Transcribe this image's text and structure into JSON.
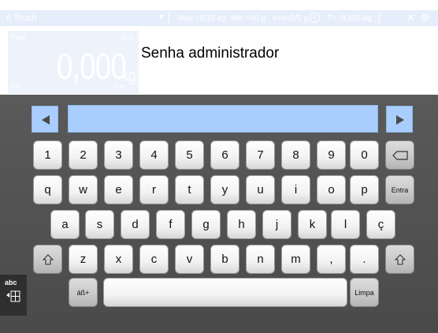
{
  "topbar": {
    "app_name": "6 Touch",
    "dropdown_glyph": "▼",
    "max": "Max =6/15 kg",
    "min": "Min =40 g",
    "e_d": "e=d=2/5 g",
    "zero_badge": "0",
    "tare": "T= -9,995 kg",
    "close_glyph": "✕",
    "settings_glyph": "⚙"
  },
  "weight_panel": {
    "peso_label": "Peso",
    "zero_label": "Zero",
    "value": "0,000",
    "unit": "kg",
    "scale_label": "3 kg",
    "tare_label": "T kg"
  },
  "prompt": "Senha administrador",
  "input": {
    "value": ""
  },
  "keyboard": {
    "row1": [
      "1",
      "2",
      "3",
      "4",
      "5",
      "6",
      "7",
      "8",
      "9",
      "0"
    ],
    "row2": [
      "q",
      "w",
      "e",
      "r",
      "t",
      "y",
      "u",
      "i",
      "o",
      "p"
    ],
    "row3": [
      "a",
      "s",
      "d",
      "f",
      "g",
      "h",
      "j",
      "k",
      "l",
      "ç"
    ],
    "row4": [
      "z",
      "x",
      "c",
      "v",
      "b",
      "n",
      "m",
      ",",
      "."
    ],
    "enter_label": "Entra",
    "symbols_label": "áß+",
    "clear_label": "Limpa",
    "mode_label": "abc"
  },
  "colors": {
    "input_blue": "#a9cdfd",
    "keyboard_bg": "#555555"
  }
}
